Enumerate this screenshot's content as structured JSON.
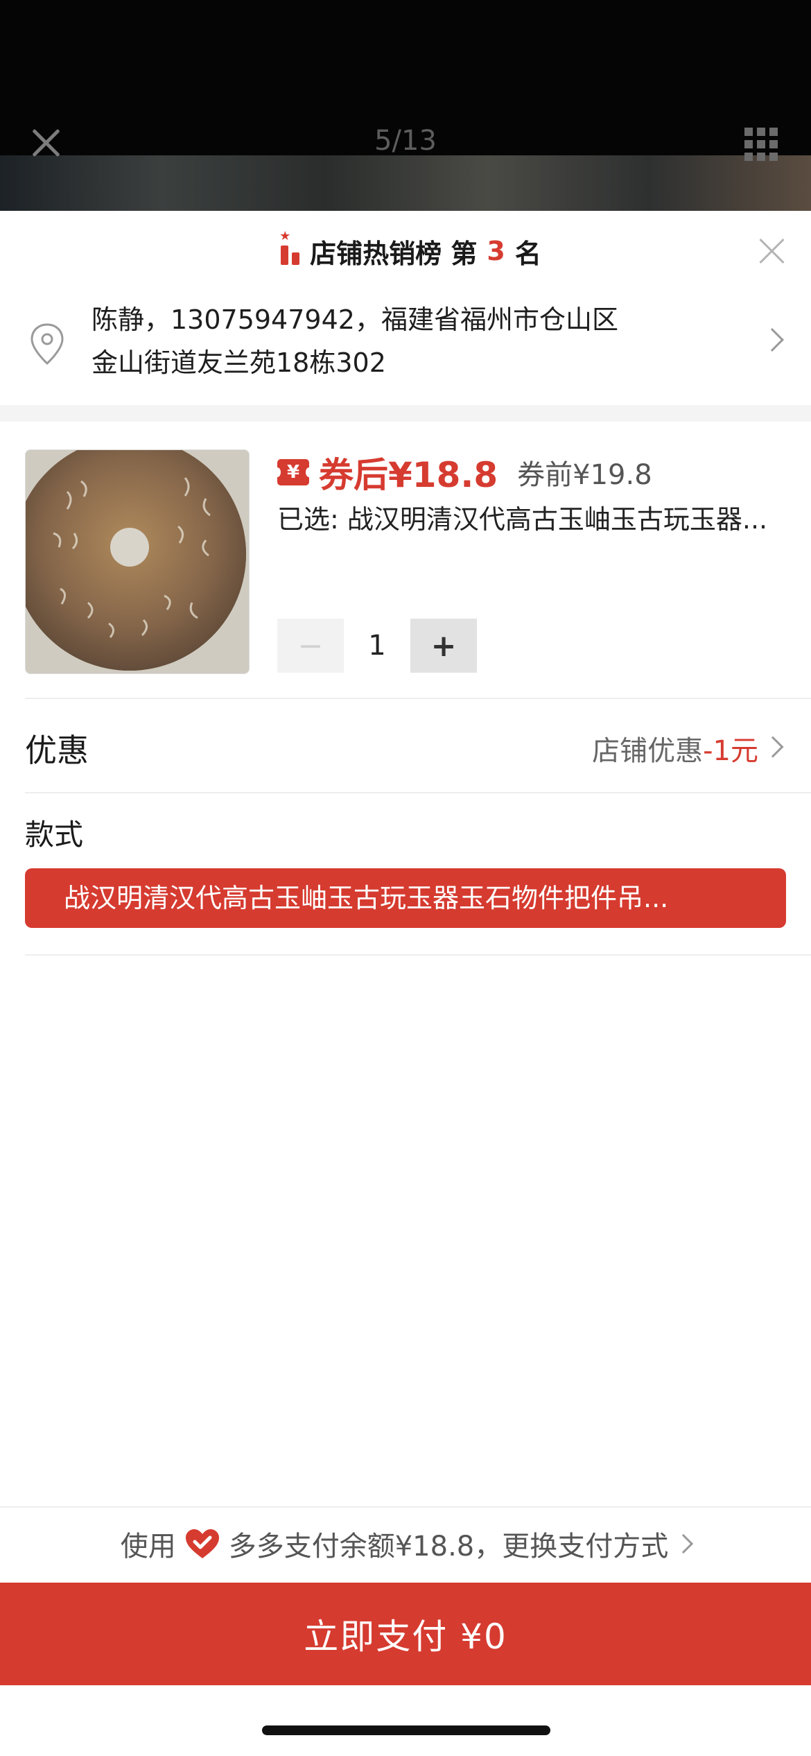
{
  "viewer": {
    "page_indicator": "5/13"
  },
  "rank": {
    "prefix": "店铺热销榜 第",
    "number": "3",
    "suffix": "名"
  },
  "address": {
    "line1": "陈静，13075947942，福建省福州市仓山区",
    "line2": "金山街道友兰苑18栋302"
  },
  "product": {
    "coupon_symbol": "¥",
    "price_after": "券后¥18.8",
    "price_before": "券前¥19.8",
    "selected": "已选: 战汉明清汉代高古玉岫玉古玩玉器...",
    "quantity": "1",
    "minus_label": "−",
    "plus_label": "+"
  },
  "promo": {
    "title": "优惠",
    "value_prefix": "店铺优惠",
    "value_amount": "-1元"
  },
  "style": {
    "label": "款式",
    "option": "战汉明清汉代高古玉岫玉古玩玉器玉石物件把件吊..."
  },
  "payment": {
    "use_label": "使用",
    "method_text": "多多支付余额¥18.8，更换支付方式",
    "pay_button": "立即支付 ¥0"
  },
  "colors": {
    "accent": "#d63b30",
    "background": "#ffffff"
  }
}
